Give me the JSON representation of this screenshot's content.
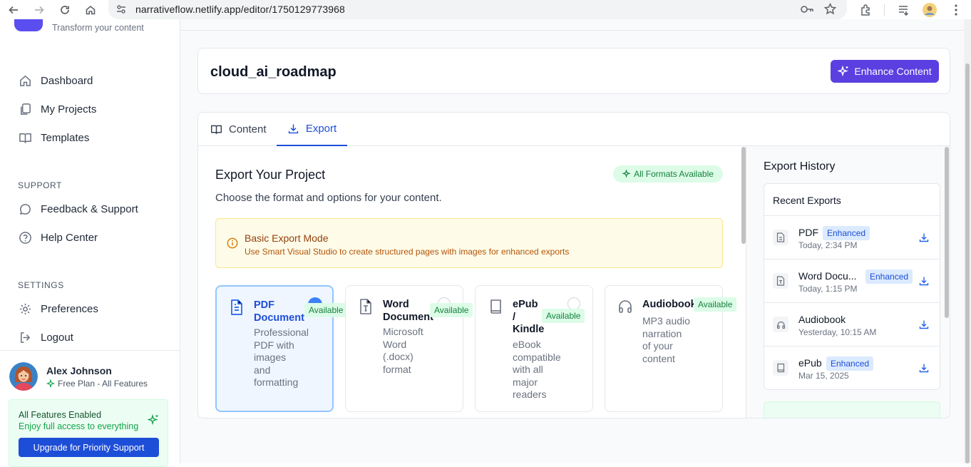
{
  "browser": {
    "url": "narrativeflow.netlify.app/editor/1750129773968"
  },
  "sidebar": {
    "tagline": "Transform your content",
    "nav": [
      {
        "label": "Dashboard",
        "icon": "home-icon"
      },
      {
        "label": "My Projects",
        "icon": "copy-icon"
      },
      {
        "label": "Templates",
        "icon": "book-open-icon"
      }
    ],
    "support_heading": "SUPPORT",
    "support": [
      {
        "label": "Feedback & Support",
        "icon": "message-circle-icon"
      },
      {
        "label": "Help Center",
        "icon": "help-circle-icon"
      }
    ],
    "settings_heading": "SETTINGS",
    "settings": [
      {
        "label": "Preferences",
        "icon": "gear-icon"
      },
      {
        "label": "Logout",
        "icon": "logout-icon"
      }
    ],
    "user": {
      "name": "Alex Johnson",
      "plan": "Free Plan - All Features"
    },
    "features_card": {
      "title": "All Features Enabled",
      "subtitle": "Enjoy full access to everything",
      "button": "Upgrade for Priority Support"
    }
  },
  "header": {
    "project_title": "cloud_ai_roadmap",
    "enhance_button": "Enhance Content"
  },
  "tabs": [
    {
      "label": "Content",
      "active": false
    },
    {
      "label": "Export",
      "active": true
    }
  ],
  "export": {
    "title": "Export Your Project",
    "subtitle": "Choose the format and options for your content.",
    "all_formats_badge": "All Formats Available",
    "notice": {
      "title": "Basic Export Mode",
      "text": "Use Smart Visual Studio to create structured pages with images for enhanced exports"
    },
    "formats": [
      {
        "name_lines": [
          "PDF",
          "Document"
        ],
        "desc_lines": [
          "Professional",
          "PDF with",
          "images",
          "and",
          "formatting"
        ],
        "badge": "Available",
        "selected": true
      },
      {
        "name_lines": [
          "Word",
          "Document"
        ],
        "desc_lines": [
          "Microsoft",
          "Word",
          "(.docx)",
          "format"
        ],
        "badge": "Available",
        "selected": false
      },
      {
        "name_lines": [
          "ePub",
          "/",
          "Kindle"
        ],
        "desc_lines": [
          "eBook",
          "compatible",
          "with all",
          "major",
          "readers"
        ],
        "badge": "Available",
        "selected": false
      },
      {
        "name_lines": [
          "Audiobook"
        ],
        "desc_lines": [
          "MP3 audio",
          "narration",
          "of your",
          "content"
        ],
        "badge": "Available",
        "selected": false
      }
    ]
  },
  "history": {
    "title": "Export History",
    "recent_heading": "Recent Exports",
    "items": [
      {
        "name": "PDF",
        "badge": "Enhanced",
        "date": "Today, 2:34 PM"
      },
      {
        "name": "Word Docu...",
        "badge": "Enhanced",
        "date": "Today, 1:15 PM"
      },
      {
        "name": "Audiobook",
        "badge": "",
        "date": "Yesterday, 10:15 AM"
      },
      {
        "name": "ePub",
        "badge": "Enhanced",
        "date": "Mar 15, 2025"
      }
    ]
  },
  "colors": {
    "accent": "#5b3fe0",
    "primary_blue": "#1d4ed8",
    "success_green": "#15803d"
  }
}
